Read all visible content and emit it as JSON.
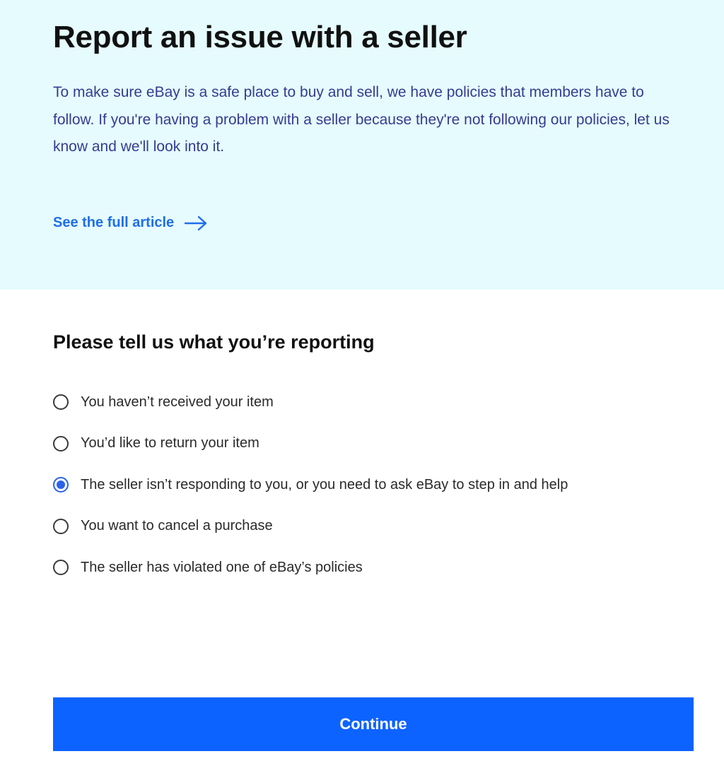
{
  "header": {
    "title": "Report an issue with a seller",
    "intro": "To make sure eBay is a safe place to buy and sell, we have policies that members have to follow. If you're having a problem with a seller because they're not following our policies, let us know and we'll look into it.",
    "article_link_label": "See the full article",
    "article_link_icon": "arrow-right-icon"
  },
  "report_form": {
    "heading": "Please tell us what you’re reporting",
    "options": [
      {
        "label": "You haven’t received your item",
        "selected": false
      },
      {
        "label": "You’d like to return your item",
        "selected": false
      },
      {
        "label": "The seller isn’t responding to you, or you need to ask eBay to step in and help",
        "selected": true
      },
      {
        "label": "You want to cancel a purchase",
        "selected": false
      },
      {
        "label": "The seller has violated one of eBay’s policies",
        "selected": false
      }
    ],
    "continue_label": "Continue"
  },
  "colors": {
    "hero_background": "#e6fbfd",
    "intro_text": "#353c92",
    "link": "#1e6fe8",
    "radio_selected": "#2a62ea",
    "primary_button": "#0d63ff"
  }
}
